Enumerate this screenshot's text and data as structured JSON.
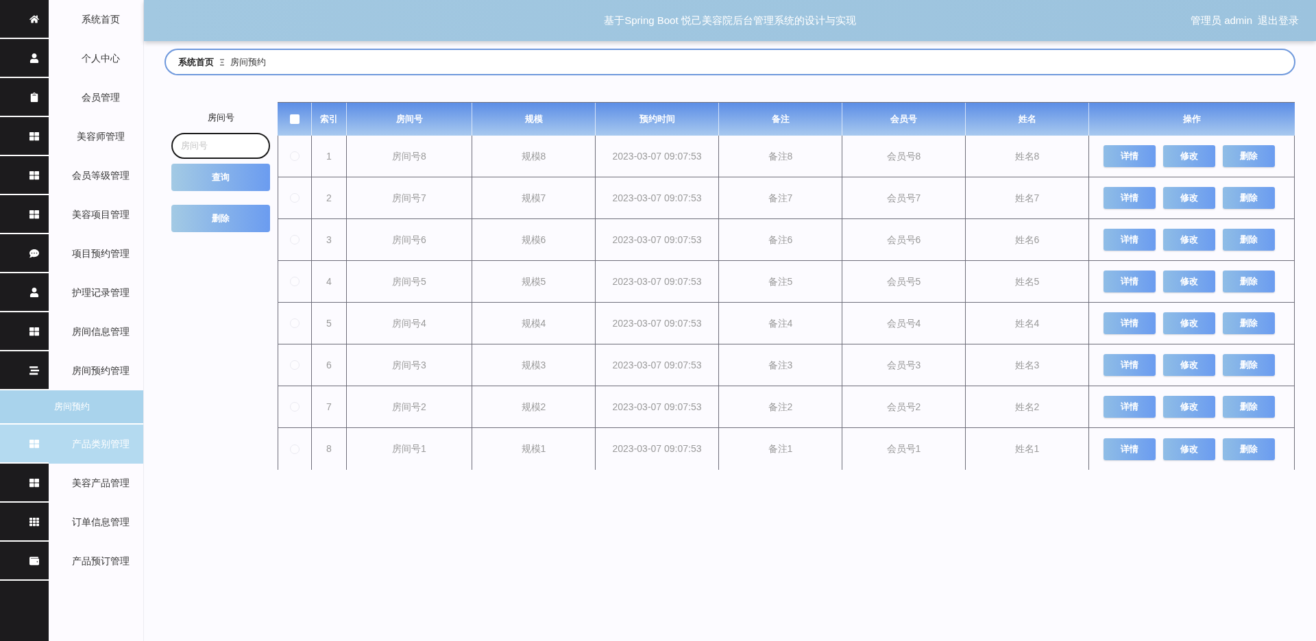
{
  "header": {
    "title": "基于Spring Boot 悦己美容院后台管理系统的设计与实现",
    "user": "管理员 admin",
    "logout": "退出登录"
  },
  "sidebar": {
    "items": [
      {
        "label": "系统首页",
        "selected": false,
        "hovered": false
      },
      {
        "label": "个人中心",
        "selected": false,
        "hovered": false
      },
      {
        "label": "会员管理",
        "selected": false,
        "hovered": false
      },
      {
        "label": "美容师管理",
        "selected": false,
        "hovered": false
      },
      {
        "label": "会员等级管理",
        "selected": false,
        "hovered": false
      },
      {
        "label": "美容项目管理",
        "selected": false,
        "hovered": false
      },
      {
        "label": "项目预约管理",
        "selected": false,
        "hovered": false
      },
      {
        "label": "护理记录管理",
        "selected": false,
        "hovered": false
      },
      {
        "label": "房间信息管理",
        "selected": false,
        "hovered": false
      },
      {
        "label": "房间预约管理",
        "selected": false,
        "hovered": false,
        "children": [
          {
            "label": "房间预约",
            "selected": true
          }
        ]
      },
      {
        "label": "产品类别管理",
        "selected": false,
        "hovered": true
      },
      {
        "label": "美容产品管理",
        "selected": false,
        "hovered": false
      },
      {
        "label": "订单信息管理",
        "selected": false,
        "hovered": false
      },
      {
        "label": "产品预订管理",
        "selected": false,
        "hovered": false
      }
    ]
  },
  "breadcrumb": [
    {
      "label": "系统首页"
    },
    {
      "label": "房间预约"
    }
  ],
  "search": {
    "label": "房间号",
    "placeholder": "房间号",
    "buttons": [
      "查询",
      "删除"
    ]
  },
  "table": {
    "select_all": {
      "checked": false
    },
    "columns": [
      "索引",
      "房间号",
      "规模",
      "预约时间",
      "备注",
      "会员号",
      "姓名",
      "操作"
    ],
    "rows": [
      {
        "checked": false,
        "cells": [
          "1",
          "房间号8",
          "规模8",
          "2023-03-07 09:07:53",
          "备注8",
          "会员号8",
          "姓名8"
        ],
        "actions": [
          "详情",
          "修改",
          "删除"
        ]
      },
      {
        "checked": false,
        "cells": [
          "2",
          "房间号7",
          "规模7",
          "2023-03-07 09:07:53",
          "备注7",
          "会员号7",
          "姓名7"
        ],
        "actions": [
          "详情",
          "修改",
          "删除"
        ]
      },
      {
        "checked": false,
        "cells": [
          "3",
          "房间号6",
          "规模6",
          "2023-03-07 09:07:53",
          "备注6",
          "会员号6",
          "姓名6"
        ],
        "actions": [
          "详情",
          "修改",
          "删除"
        ]
      },
      {
        "checked": false,
        "cells": [
          "4",
          "房间号5",
          "规模5",
          "2023-03-07 09:07:53",
          "备注5",
          "会员号5",
          "姓名5"
        ],
        "actions": [
          "详情",
          "修改",
          "删除"
        ]
      },
      {
        "checked": false,
        "cells": [
          "5",
          "房间号4",
          "规模4",
          "2023-03-07 09:07:53",
          "备注4",
          "会员号4",
          "姓名4"
        ],
        "actions": [
          "详情",
          "修改",
          "删除"
        ]
      },
      {
        "checked": false,
        "cells": [
          "6",
          "房间号3",
          "规模3",
          "2023-03-07 09:07:53",
          "备注3",
          "会员号3",
          "姓名3"
        ],
        "actions": [
          "详情",
          "修改",
          "删除"
        ]
      },
      {
        "checked": false,
        "cells": [
          "7",
          "房间号2",
          "规模2",
          "2023-03-07 09:07:53",
          "备注2",
          "会员号2",
          "姓名2"
        ],
        "actions": [
          "详情",
          "修改",
          "删除"
        ]
      },
      {
        "checked": false,
        "cells": [
          "8",
          "房间号1",
          "规模1",
          "2023-03-07 09:07:53",
          "备注1",
          "会员号1",
          "姓名1"
        ],
        "actions": [
          "详情",
          "修改",
          "删除"
        ]
      }
    ]
  }
}
